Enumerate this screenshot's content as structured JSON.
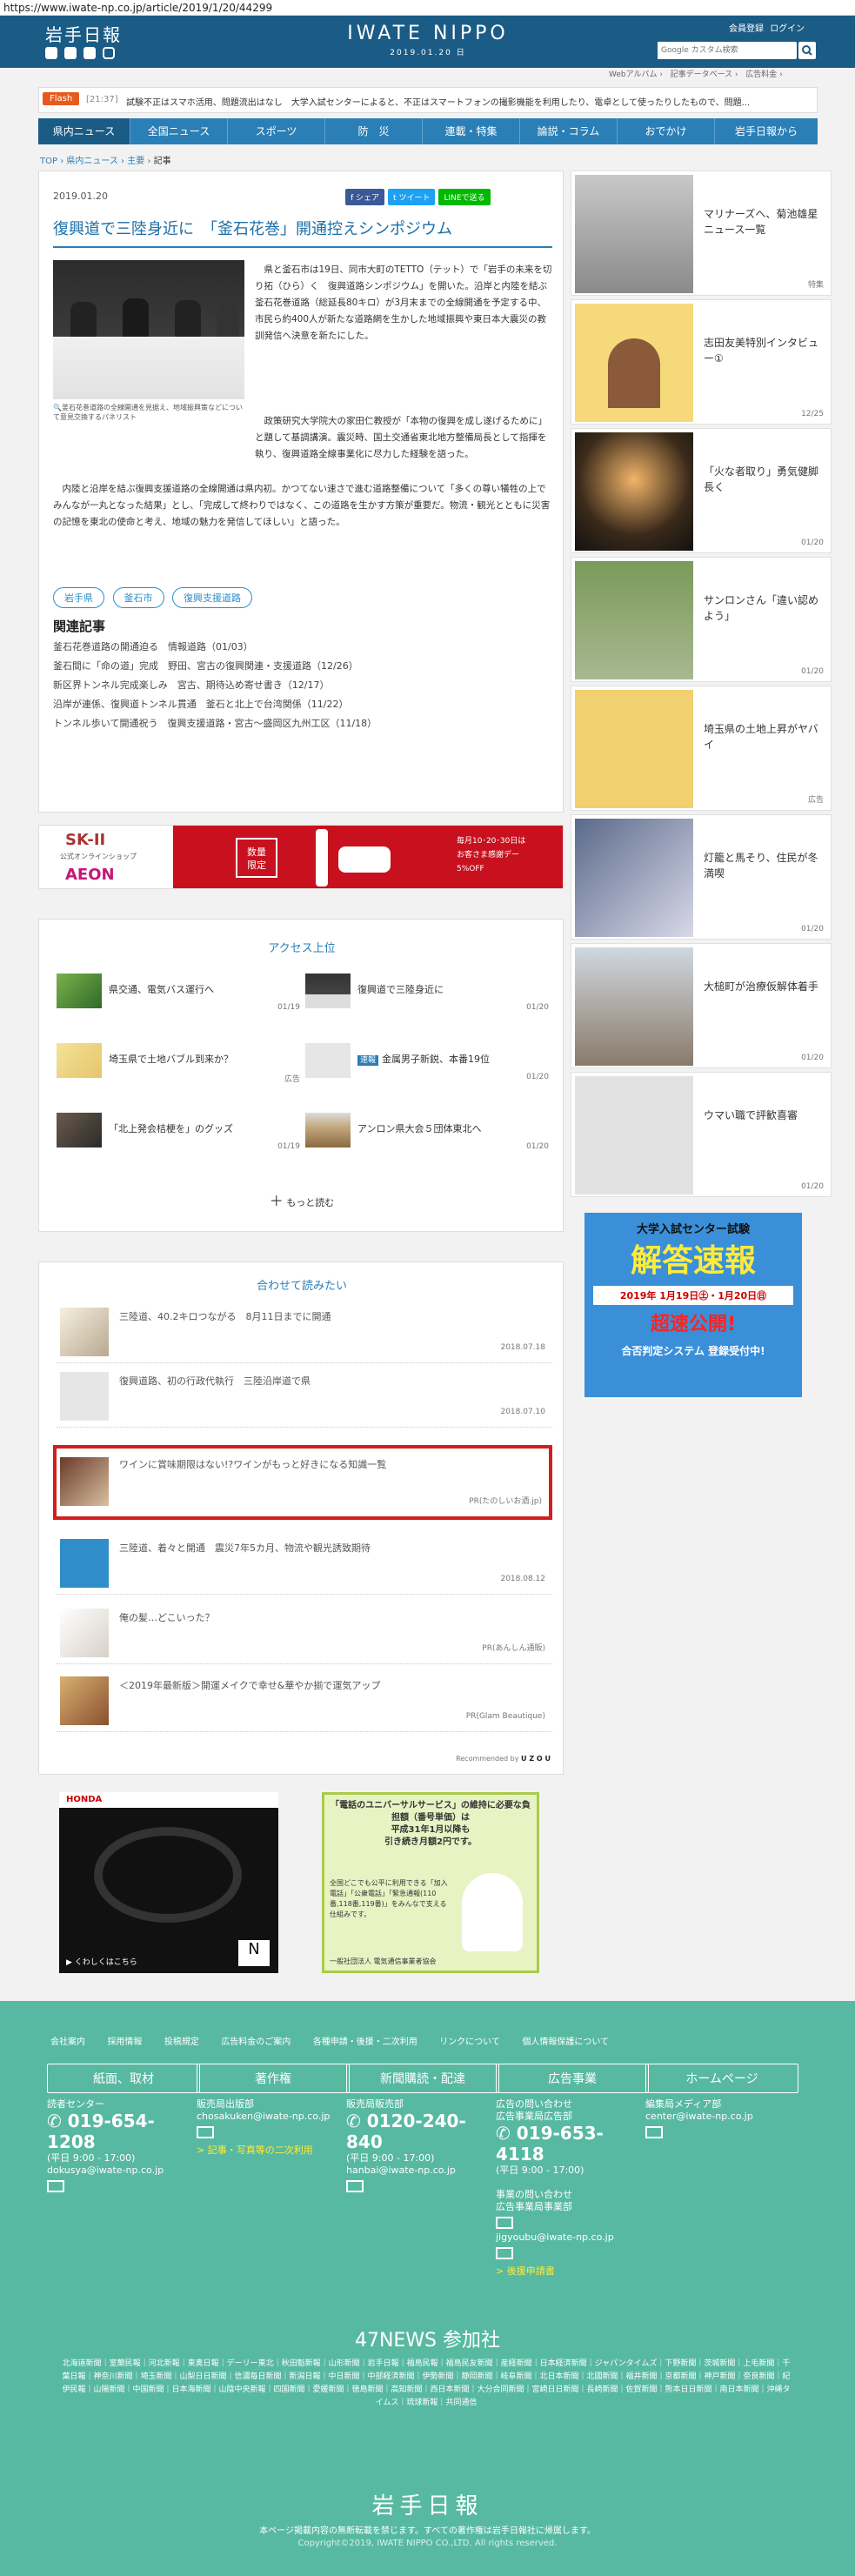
{
  "url": "https://www.iwate-np.co.jp/article/2019/1/20/44299",
  "header": {
    "logo": "岩手日報",
    "center_title": "IWATE NIPPO",
    "center_date": "2019.01.20 日",
    "member": "会員登録",
    "login": "ログイン",
    "search_placeholder": "Google カスタム検索",
    "sublinks": [
      "Webアルバム ›",
      "記事データベース ›",
      "広告料金 ›"
    ]
  },
  "flash": {
    "label": "Flash",
    "time": "[21:37]",
    "text": "試験不正はスマホ活用、問題流出はなし　大学入試センターによると、不正はスマートフォンの撮影機能を利用したり、電卓として使ったりしたもので、問題..."
  },
  "nav": [
    "県内ニュース",
    "全国ニュース",
    "スポーツ",
    "防　災",
    "連載・特集",
    "論説・コラム",
    "おでかけ",
    "岩手日報から"
  ],
  "breadcrumb": [
    "TOP",
    "県内ニュース",
    "主要",
    "記事"
  ],
  "article": {
    "date": "2019.01.20",
    "share": [
      "シェア",
      "ツイート",
      "LINEで送る"
    ],
    "title": "復興道で三陸身近に　「釜石花巻」開通控えシンポジウム",
    "caption": "釜石花巻道路の全線開通を見据え、地域振興策などについて意見交換するパネリスト",
    "body1": "県と釜石市は19日、同市大町のTETTO（テット）で「岩手の未来を切り拓（ひら）く　復興道路シンポジウム」を開いた。沿岸と内陸を結ぶ釜石花巻道路（総延長80キロ）が3月末までの全線開通を予定する中、市民ら約400人が新たな道路網を生かした地域振興や東日本大震災の教訓発信へ決意を新たにした。",
    "body2": "政策研究大学院大の家田仁教授が「本物の復興を成し遂げるために」と題して基調講演。震災時、国土交通省東北地方整備局長として指揮を執り、復興道路全線事業化に尽力した経験を語った。",
    "body3": "内陸と沿岸を結ぶ復興支援道路の全線開通は県内初。かつてない速さで進む道路整備について「多くの尊い犠牲の上でみんなが一丸となった結果」とし、「完成して終わりではなく、この道路を生かす方策が重要だ。物流・観光とともに災害の記憶を東北の使命と考え、地域の魅力を発信してほしい」と語った。",
    "tags": [
      "岩手県",
      "釜石市",
      "復興支援道路"
    ],
    "related_title": "関連記事",
    "related": [
      "釜石花巻道路の開通迫る　情報道路（01/03）",
      "釜石間に「命の道」完成　野田、宮古の復興関連・支援道路（12/26）",
      "新区界トンネル完成楽しみ　宮古、期待込め寄せ書き（12/17）",
      "沿岸が連係、復興道トンネル貫通　釜石と北上で台湾関係（11/22）",
      "トンネル歩いて開通祝う　復興支援道路・宮古～盛岡区九州工区（11/18）"
    ]
  },
  "ad_banner": {
    "brand1": "SK-II",
    "brand1_sub": "公式オンラインショップ",
    "brand2": "AEON",
    "badge": "数量\n限定",
    "right_text": "毎月10･20･30日は\nお客さま感謝デー\n5%OFF"
  },
  "access": {
    "title": "アクセス上位",
    "items": [
      {
        "text": "県交通、電気バス運行へ",
        "date": "01/19"
      },
      {
        "text": "復興道で三陸身近に",
        "date": "01/20"
      },
      {
        "text": "埼玉県で土地バブル到来か？",
        "date": "広告"
      },
      {
        "text": "金属男子新鋭、本番19位",
        "date": "01/20",
        "badge": "速報"
      },
      {
        "text": "「北上発会桔梗を」のグッズ",
        "date": "01/19"
      },
      {
        "text": "アンロン県大会５団体東北へ",
        "date": "01/20"
      }
    ],
    "more": "もっと読む"
  },
  "recommend": {
    "title": "合わせて読みたい",
    "items": [
      {
        "text": "三陸道、40.2キロつながる　8月11日までに開通",
        "date": "2018.07.18"
      },
      {
        "text": "復興道路、初の行政代執行　三陸沿岸道で県",
        "date": "2018.07.10"
      },
      {
        "text": "ワインに賞味期限はない!?ワインがもっと好きになる知識一覧",
        "date": "PR(たのしいお酒.jp)"
      },
      {
        "text": "三陸道、着々と開通　震災7年5カ月、物流や観光誘致期待",
        "date": "2018.08.12"
      },
      {
        "text": "俺の髪…どこいった？",
        "date": "PR(あんしん通販)"
      },
      {
        "text": "＜2019年最新版＞開運メイクで幸せ&華やか揃で運気アップ",
        "date": "PR(Glam Beautique)"
      }
    ],
    "credit": "Recommended by"
  },
  "sidebar": [
    {
      "title": "マリナーズへ、菊池雄星ニュース一覧",
      "date": "特集"
    },
    {
      "title": "志田友美特別インタビュー①",
      "date": "12/25"
    },
    {
      "title": "「火な者取り」勇気健脚長く",
      "date": "01/20"
    },
    {
      "title": "サンロンさん「違い認めよう」",
      "date": "01/20"
    },
    {
      "title": "埼玉県の土地上昇がヤバイ",
      "date": "広告"
    },
    {
      "title": "灯籠と馬そり、住民が冬満喫",
      "date": "01/20"
    },
    {
      "title": "大槌町が治療仮解体着手",
      "date": "01/20"
    },
    {
      "title": "ウマい職で評歓喜審",
      "date": "01/20"
    }
  ],
  "side_ad": {
    "line1": "大学入試センター試験",
    "line2": "解答速報",
    "line3": "2019年 1月19日㊏・1月20日㊐",
    "line4": "超速公開!",
    "line5": "合否判定システム 登録受付中!"
  },
  "bottom_ads": {
    "honda": "HONDA",
    "honda_sub": "▶ くわしくはこちら",
    "ntt": "「電話のユニバーサルサービス」の維持に必要な負担額（番号単価）は\n平成31年1月以降も\n引き続き月額2円です。",
    "ntt_sub": "全国どこでも公平に利用できる「加入電話」「公衆電話」「緊急通報(110番,118番,119番)」をみんなで支える仕組みです。",
    "ntt_org": "一般社団法人 電気通信事業者協会"
  },
  "footer": {
    "links": [
      "会社案内",
      "採用情報",
      "投稿規定",
      "広告料金のご案内",
      "各種申請・後援・二次利用",
      "リンクについて",
      "個人情報保護について"
    ],
    "cols": [
      {
        "head": "紙面、取材",
        "lbl": "読者センター",
        "tel": "019-654-1208",
        "hours": "(平日 9:00 - 17:00)",
        "mail": "dokusya@iwate-np.co.jp"
      },
      {
        "head": "著作権",
        "lbl": "販売局出版部",
        "mail": "chosakuken@iwate-np.co.jp",
        "note": "> 記事・写真等の二次利用"
      },
      {
        "head": "新聞購読・配達",
        "lbl": "販売局販売部",
        "tel": "0120-240-840",
        "hours": "(平日 9:00 - 17:00)",
        "mail": "hanbai@iwate-np.co.jp"
      },
      {
        "head": "広告事業",
        "lbl": "広告の問い合わせ\n広告事業局広告部",
        "tel": "019-653-4118",
        "hours": "(平日 9:00 - 17:00)",
        "lbl2": "事業の問い合わせ\n広告事業局事業部",
        "mail": "jigyoubu@iwate-np.co.jp",
        "note": "> 後援申請書"
      },
      {
        "head": "ホームページ",
        "lbl": "編集局メディア部",
        "mail": "center@iwate-np.co.jp"
      }
    ],
    "news47": "47NEWS 参加社",
    "papers": "北海道新聞｜室蘭民報｜河北新報｜東奥日報｜デーリー東北｜秋田魁新報｜山形新聞｜岩手日報｜福島民報｜福島民友新聞｜産経新聞｜日本経済新聞｜ジャパンタイムズ｜下野新聞｜茨城新聞｜上毛新聞｜千葉日報｜神奈川新聞｜埼玉新聞｜山梨日日新聞｜信濃毎日新聞｜新潟日報｜中日新聞｜中部経済新聞｜伊勢新聞｜静岡新聞｜岐阜新聞｜北日本新聞｜北國新聞｜福井新聞｜京都新聞｜神戸新聞｜奈良新聞｜紀伊民報｜山陽新聞｜中国新聞｜日本海新聞｜山陰中央新報｜四国新聞｜愛媛新聞｜徳島新聞｜高知新聞｜西日本新聞｜大分合同新聞｜宮崎日日新聞｜長崎新聞｜佐賀新聞｜熊本日日新聞｜南日本新聞｜沖縄タイムス｜琉球新報｜共同通信",
    "logo": "岩手日報",
    "notice": "本ページ掲載内容の無断転載を禁じます。すべての著作権は岩手日報社に帰属します。",
    "copyright": "Copyright©2019, IWATE NIPPO CO.,LTD. All rights reserved."
  }
}
